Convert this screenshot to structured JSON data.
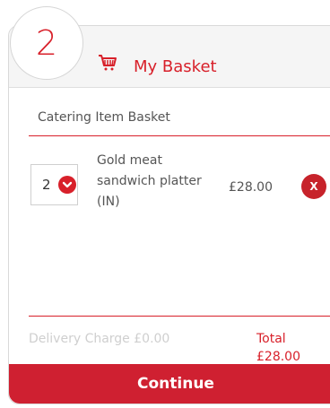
{
  "checkout": {
    "step_number": "2",
    "basket_title": "My Basket",
    "section_title": "Catering Item Basket"
  },
  "basket_item": {
    "quantity": "2",
    "name": "Gold meat sandwich platter (IN)",
    "price": "£28.00",
    "remove_label": "X"
  },
  "summary": {
    "delivery_charge": "Delivery Charge £0.00",
    "total": "Total £28.00"
  },
  "actions": {
    "continue_label": "Continue"
  },
  "icons": {
    "basket": "basket-icon",
    "quantity_dropdown": "chevron-down-icon",
    "remove": "close-icon"
  },
  "colors": {
    "accent": "#d8202a",
    "button": "#cf2031",
    "muted_text": "#cfcfcf"
  }
}
